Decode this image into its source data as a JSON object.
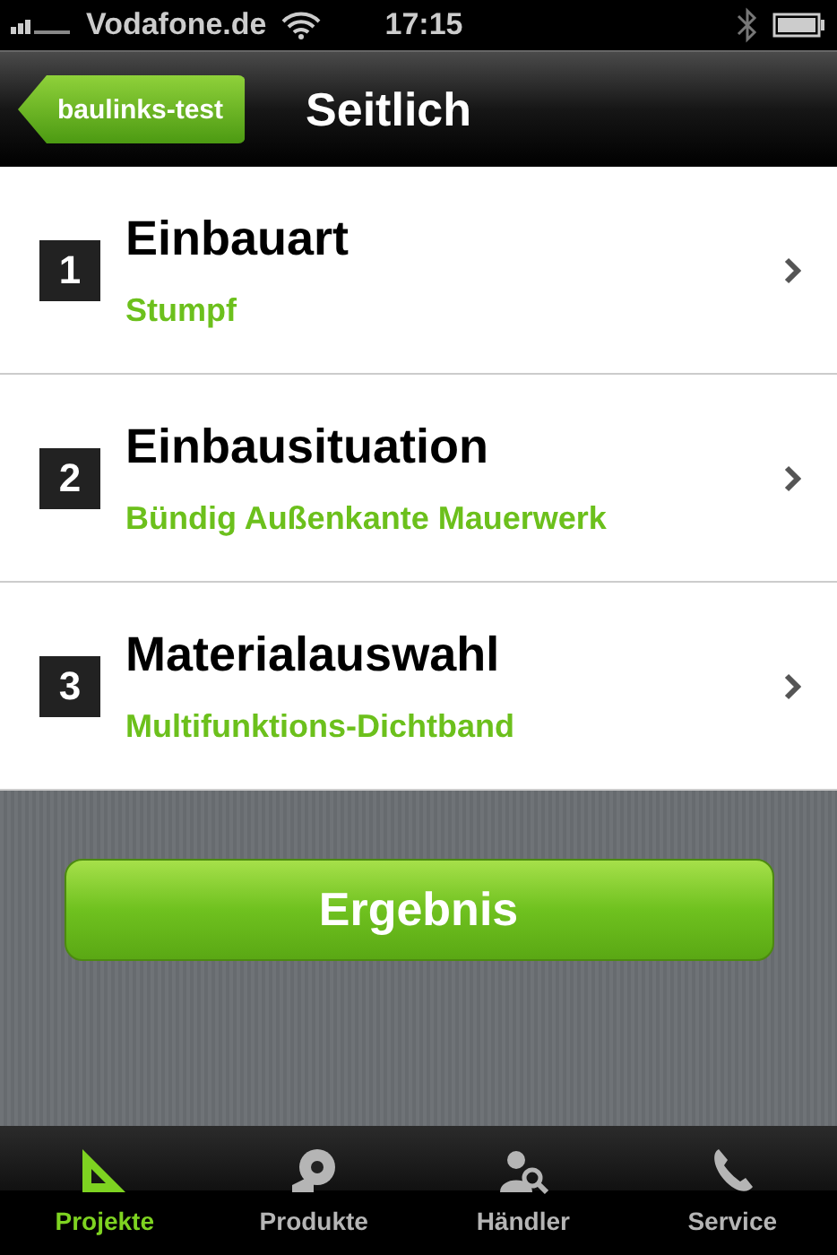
{
  "status_bar": {
    "carrier": "Vodafone.de",
    "time": "17:15"
  },
  "nav": {
    "back": "baulinks-test",
    "title": "Seitlich"
  },
  "steps": [
    {
      "number": "1",
      "title": "Einbauart",
      "value": "Stumpf"
    },
    {
      "number": "2",
      "title": "Einbausituation",
      "value": "Bündig Außenkante Mauerwerk"
    },
    {
      "number": "3",
      "title": "Materialauswahl",
      "value": "Multifunktions-Dichtband"
    }
  ],
  "result_button": "Ergebnis",
  "tabs": [
    {
      "label": "Projekte",
      "kind": "triangle",
      "selected": true
    },
    {
      "label": "Produkte",
      "kind": "tape",
      "selected": false
    },
    {
      "label": "Händler",
      "kind": "dealer",
      "selected": false
    },
    {
      "label": "Service",
      "kind": "phone",
      "selected": false
    }
  ]
}
